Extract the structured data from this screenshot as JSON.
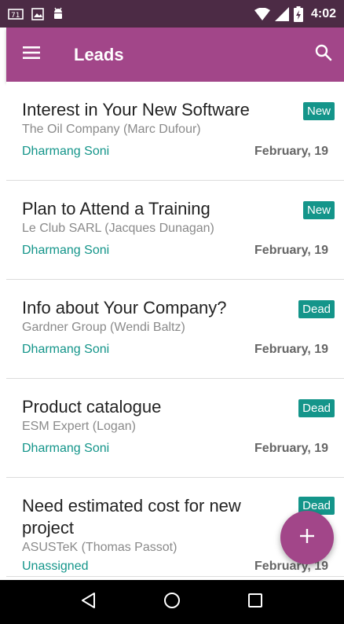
{
  "status_bar": {
    "time": "4:02",
    "left_icons": [
      "sim-card-icon",
      "image-icon",
      "android-icon"
    ],
    "right_icons": [
      "wifi-icon",
      "signal-icon",
      "battery-icon"
    ]
  },
  "app_bar": {
    "title": "Leads",
    "menu_icon": "hamburger-menu-icon",
    "search_icon": "search-icon"
  },
  "colors": {
    "status_bar": "#4c2b45",
    "app_bar": "#a24689",
    "accent": "#14958a",
    "fab": "#a24689"
  },
  "leads": [
    {
      "title": "Interest in Your New Software",
      "company": "The Oil Company (Marc Dufour)",
      "salesperson": "Dharmang Soni",
      "date": "February, 19",
      "stage": "New"
    },
    {
      "title": "Plan to Attend a Training",
      "company": "Le Club SARL (Jacques Dunagan)",
      "salesperson": "Dharmang Soni",
      "date": "February, 19",
      "stage": "New"
    },
    {
      "title": "Info about Your Company?",
      "company": "Gardner Group (Wendi Baltz)",
      "salesperson": "Dharmang Soni",
      "date": "February, 19",
      "stage": "Dead"
    },
    {
      "title": "Product catalogue",
      "company": "ESM Expert (Logan)",
      "salesperson": "Dharmang Soni",
      "date": "February, 19",
      "stage": "Dead"
    },
    {
      "title": "Need estimated cost for new project",
      "company": "ASUSTeK (Thomas Passot)",
      "salesperson": "Unassigned",
      "date": "February, 19",
      "stage": "Dead"
    }
  ],
  "fab": {
    "icon": "plus-icon"
  },
  "nav_bar": {
    "icons": [
      "back-icon",
      "home-icon",
      "recents-icon"
    ]
  }
}
